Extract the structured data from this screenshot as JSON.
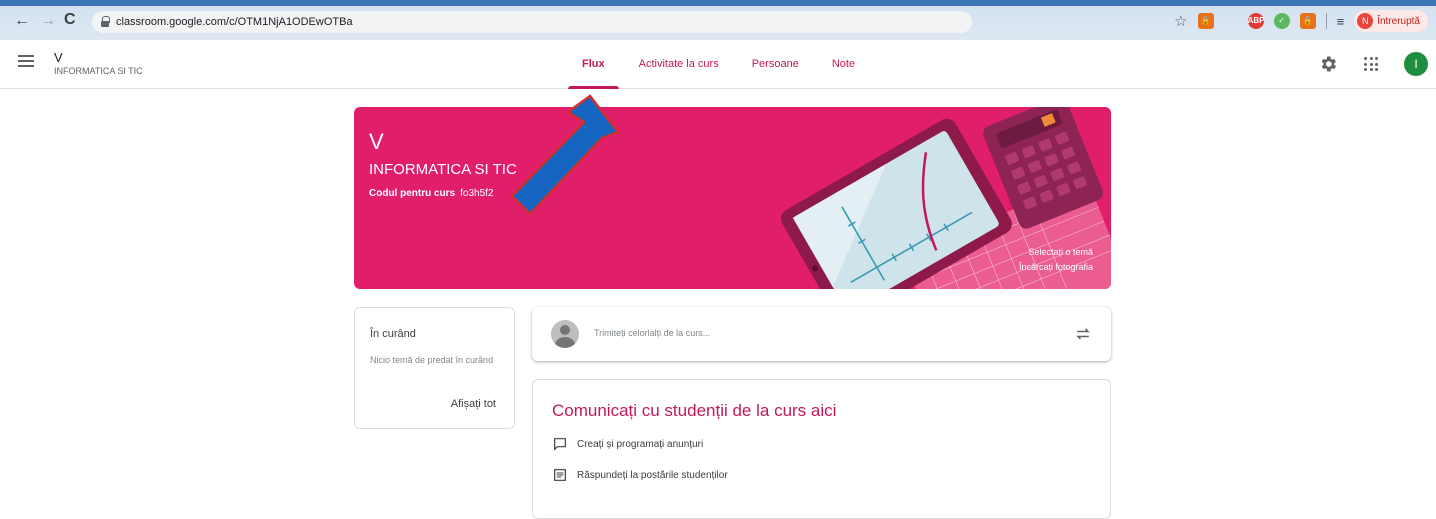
{
  "browser": {
    "url": "classroom.google.com/c/OTM1NjA1ODEwOTBa",
    "profile_initial": "N",
    "profile_status": "Întreruptă",
    "extensions": [
      "ABP"
    ]
  },
  "header": {
    "class_name": "V",
    "class_subtitle": "INFORMATICA SI TIC",
    "tabs": [
      {
        "label": "Flux",
        "active": true
      },
      {
        "label": "Activitate la curs"
      },
      {
        "label": "Persoane"
      },
      {
        "label": "Note"
      }
    ],
    "user_initial": "I"
  },
  "banner": {
    "title": "V",
    "subtitle": "INFORMATICA SI TIC",
    "code_label": "Codul pentru curs",
    "code_value": "fo3h5f2",
    "select_theme": "Selectați o temă",
    "upload_photo": "Încărcați fotografia",
    "color": "#e01e6a"
  },
  "upcoming": {
    "title": "În curând",
    "message": "Nicio temă de predat în curând",
    "view_all": "Afișați tot"
  },
  "share": {
    "placeholder": "Trimiteți celorlalți de la curs..."
  },
  "communicate": {
    "heading": "Comunicați cu studenții de la curs aici",
    "items": [
      {
        "icon": "announcement-icon",
        "label": "Creați și programați anunțuri"
      },
      {
        "icon": "reply-icon",
        "label": "Răspundeți la postările studenților"
      }
    ]
  },
  "colors": {
    "accent": "#c2185b",
    "arrow_fill": "#1565c0",
    "arrow_outline": "#d32f2f"
  }
}
